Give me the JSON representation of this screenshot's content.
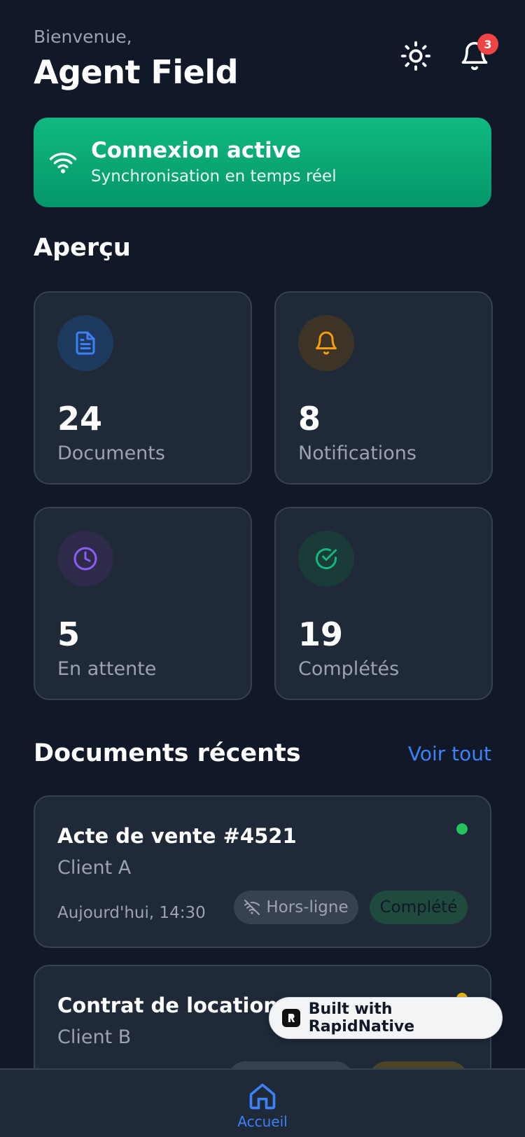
{
  "header": {
    "welcome": "Bienvenue,",
    "name": "Agent Field",
    "notification_count": "3"
  },
  "connection": {
    "title": "Connexion active",
    "subtitle": "Synchronisation en temps réel"
  },
  "overview": {
    "title": "Aperçu",
    "stats": [
      {
        "value": "24",
        "label": "Documents",
        "icon": "document-icon",
        "color": "#3b82f6"
      },
      {
        "value": "8",
        "label": "Notifications",
        "icon": "bell-icon",
        "color": "#f59e0b"
      },
      {
        "value": "5",
        "label": "En attente",
        "icon": "clock-icon",
        "color": "#8b5cf6"
      },
      {
        "value": "19",
        "label": "Complétés",
        "icon": "check-circle-icon",
        "color": "#10b981"
      }
    ]
  },
  "recent": {
    "title": "Documents récents",
    "see_all": "Voir tout",
    "docs": [
      {
        "title": "Acte de vente #4521",
        "client": "Client A",
        "date": "Aujourd'hui, 14:30",
        "sync": "Hors-ligne",
        "status": "Complété",
        "dot_color": "#22c55e"
      },
      {
        "title": "Contrat de location #8823",
        "client": "Client B",
        "dot_color": "#eab308"
      }
    ]
  },
  "branding": {
    "label": "Built with RapidNative"
  },
  "nav": {
    "home": "Accueil"
  }
}
